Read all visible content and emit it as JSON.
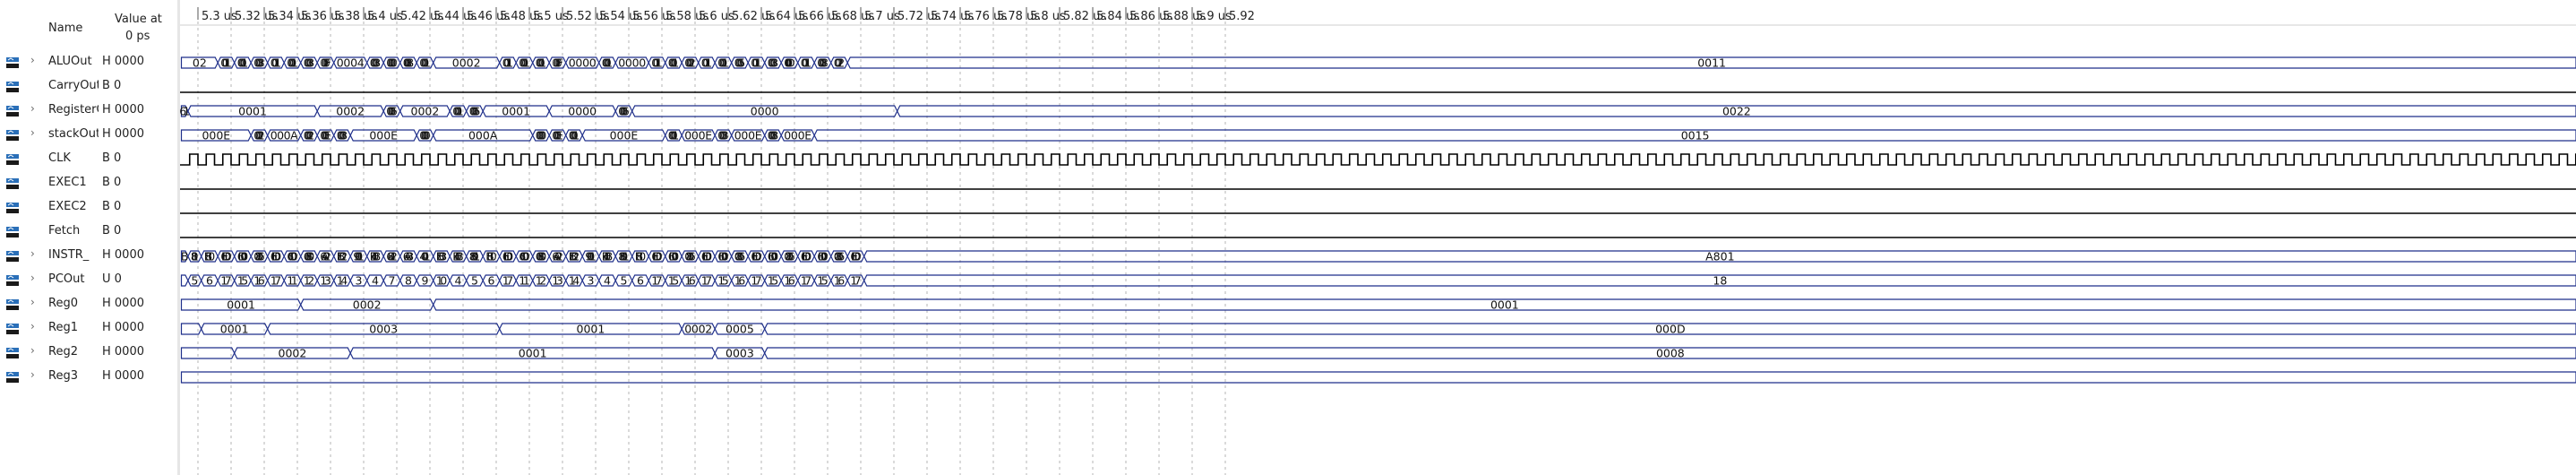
{
  "header": {
    "name_label": "Name",
    "value_label_line1": "Value at",
    "value_label_line2": "0 ps"
  },
  "colors": {
    "bus": "#1f2f8a",
    "clock": "#000000",
    "grid": "#b4b4b4",
    "icon_blue": "#2a6fb8",
    "icon_dark": "#1a1a1a"
  },
  "timeline": {
    "unit": "us",
    "ticks": [
      "5.3 us",
      "5.32 us",
      "5.34 us",
      "5.36 us",
      "5.38 us",
      "5.4 us",
      "5.42 us",
      "5.44 us",
      "5.46 us",
      "5.48 us",
      "5.5 us",
      "5.52 us",
      "5.54 us",
      "5.56 us",
      "5.58 us",
      "5.6 us",
      "5.62 us",
      "5.64 us",
      "5.66 us",
      "5.68 us",
      "5.7 us",
      "5.72 us",
      "5.74 us",
      "5.76 us",
      "5.78 us",
      "5.8 us",
      "5.82 us",
      "5.84 us",
      "5.86 us",
      "5.88 us",
      "5.9 us",
      "5.92"
    ],
    "start": 5.292,
    "end": 5.928,
    "data_end": 5.721
  },
  "signals": [
    {
      "name": "ALUOut",
      "value": "H 0000",
      "expandable": true,
      "kind": "bus",
      "segments": [
        [
          5.29,
          "02"
        ],
        [
          5.312,
          "0011"
        ],
        [
          5.322,
          "0001"
        ],
        [
          5.332,
          "0003"
        ],
        [
          5.342,
          "0011"
        ],
        [
          5.352,
          "0001"
        ],
        [
          5.362,
          "0003"
        ],
        [
          5.372,
          "000F"
        ],
        [
          5.382,
          "0004"
        ],
        [
          5.402,
          "0003"
        ],
        [
          5.412,
          "0000"
        ],
        [
          5.422,
          "000B"
        ],
        [
          5.432,
          "0001"
        ],
        [
          5.442,
          "0002"
        ],
        [
          5.482,
          "0011"
        ],
        [
          5.492,
          "0001"
        ],
        [
          5.502,
          "0001"
        ],
        [
          5.512,
          "000F"
        ],
        [
          5.522,
          "0000"
        ],
        [
          5.542,
          "0001"
        ],
        [
          5.552,
          "0000"
        ],
        [
          5.572,
          "0011"
        ],
        [
          5.582,
          "0001"
        ],
        [
          5.592,
          "0002"
        ],
        [
          5.602,
          "0011"
        ],
        [
          5.612,
          "0001"
        ],
        [
          5.622,
          "0005"
        ],
        [
          5.632,
          "0011"
        ],
        [
          5.642,
          "0003"
        ],
        [
          5.652,
          "000D"
        ],
        [
          5.662,
          "0011"
        ],
        [
          5.672,
          "0008"
        ],
        [
          5.682,
          "0022"
        ],
        [
          5.692,
          "0011"
        ]
      ]
    },
    {
      "name": "CarryOut",
      "value": "B 0",
      "expandable": false,
      "kind": "bit",
      "segments": [
        [
          5.29,
          0
        ]
      ]
    },
    {
      "name": "RegisterOut",
      "value": "H 0000",
      "expandable": true,
      "kind": "bus",
      "segments": [
        [
          5.29,
          "16"
        ],
        [
          5.294,
          "0001"
        ],
        [
          5.372,
          "0002"
        ],
        [
          5.412,
          "0006"
        ],
        [
          5.422,
          "0002"
        ],
        [
          5.452,
          "0001"
        ],
        [
          5.462,
          "0006"
        ],
        [
          5.472,
          "0001"
        ],
        [
          5.512,
          "0000"
        ],
        [
          5.552,
          "0006"
        ],
        [
          5.562,
          "0000"
        ],
        [
          5.722,
          "0022"
        ]
      ]
    },
    {
      "name": "stackOut",
      "value": "H 0000",
      "expandable": true,
      "kind": "bus",
      "segments": [
        [
          5.29,
          "000E"
        ],
        [
          5.332,
          "0002"
        ],
        [
          5.342,
          "000A"
        ],
        [
          5.362,
          "0002"
        ],
        [
          5.372,
          "000E"
        ],
        [
          5.382,
          "0003"
        ],
        [
          5.392,
          "000E"
        ],
        [
          5.432,
          "0000"
        ],
        [
          5.442,
          "000A"
        ],
        [
          5.502,
          "0000"
        ],
        [
          5.512,
          "000E"
        ],
        [
          5.522,
          "0001"
        ],
        [
          5.532,
          "000E"
        ],
        [
          5.582,
          "0001"
        ],
        [
          5.592,
          "000E"
        ],
        [
          5.612,
          "0003"
        ],
        [
          5.622,
          "000E"
        ],
        [
          5.642,
          "0008"
        ],
        [
          5.652,
          "000E"
        ],
        [
          5.672,
          "0015"
        ]
      ]
    },
    {
      "name": "CLK",
      "value": "B 0",
      "expandable": false,
      "kind": "clock",
      "period": 0.01
    },
    {
      "name": "EXEC1",
      "value": "B 0",
      "expandable": false,
      "kind": "bit",
      "segments": [
        [
          5.29,
          0
        ]
      ]
    },
    {
      "name": "EXEC2",
      "value": "B 0",
      "expandable": false,
      "kind": "bit",
      "segments": [
        [
          5.29,
          0
        ]
      ]
    },
    {
      "name": "Fetch",
      "value": "B 0",
      "expandable": false,
      "kind": "bit",
      "segments": [
        [
          5.29,
          0
        ]
      ]
    },
    {
      "name": "INSTR_",
      "value": "H 0000",
      "expandable": true,
      "kind": "bus",
      "segments": [
        [
          5.29,
          "B"
        ],
        [
          5.294,
          "8801"
        ],
        [
          5.302,
          "E810"
        ],
        [
          5.312,
          "6ED0"
        ],
        [
          5.322,
          "6D00"
        ],
        [
          5.332,
          "0806"
        ],
        [
          5.342,
          "6ED0"
        ],
        [
          5.352,
          "6C00"
        ],
        [
          5.362,
          "6880"
        ],
        [
          5.372,
          "6A02"
        ],
        [
          5.382,
          "E802"
        ],
        [
          5.392,
          "9001"
        ],
        [
          5.402,
          "E40B"
        ],
        [
          5.412,
          "6842"
        ],
        [
          5.422,
          "6A03"
        ],
        [
          5.432,
          "4001"
        ],
        [
          5.442,
          "E803"
        ],
        [
          5.452,
          "E40B"
        ],
        [
          5.462,
          "8801"
        ],
        [
          5.472,
          "E810"
        ],
        [
          5.482,
          "6ED0"
        ],
        [
          5.492,
          "6C00"
        ],
        [
          5.502,
          "6880"
        ],
        [
          5.512,
          "6A02"
        ],
        [
          5.522,
          "E802"
        ],
        [
          5.532,
          "9001"
        ],
        [
          5.542,
          "E40B"
        ],
        [
          5.552,
          "8801"
        ],
        [
          5.562,
          "E810"
        ],
        [
          5.572,
          "6ED0"
        ],
        [
          5.582,
          "6D00"
        ],
        [
          5.592,
          "0806"
        ],
        [
          5.602,
          "6ED0"
        ],
        [
          5.612,
          "6D00"
        ],
        [
          5.622,
          "0806"
        ],
        [
          5.632,
          "6ED0"
        ],
        [
          5.642,
          "6D00"
        ],
        [
          5.652,
          "0806"
        ],
        [
          5.662,
          "6ED0"
        ],
        [
          5.672,
          "6D00"
        ],
        [
          5.682,
          "0806"
        ],
        [
          5.692,
          "6ED0"
        ],
        [
          5.702,
          "A801"
        ]
      ]
    },
    {
      "name": "PCOut",
      "value": "U 0",
      "expandable": true,
      "kind": "bus",
      "segments": [
        [
          5.29,
          ""
        ],
        [
          5.294,
          "5"
        ],
        [
          5.302,
          "6"
        ],
        [
          5.312,
          "17"
        ],
        [
          5.322,
          "15"
        ],
        [
          5.332,
          "16"
        ],
        [
          5.342,
          "17"
        ],
        [
          5.352,
          "11"
        ],
        [
          5.362,
          "12"
        ],
        [
          5.372,
          "13"
        ],
        [
          5.382,
          "14"
        ],
        [
          5.392,
          "3"
        ],
        [
          5.402,
          "4"
        ],
        [
          5.412,
          "7"
        ],
        [
          5.422,
          "8"
        ],
        [
          5.432,
          "9"
        ],
        [
          5.442,
          "10"
        ],
        [
          5.452,
          "4"
        ],
        [
          5.462,
          "5"
        ],
        [
          5.472,
          "6"
        ],
        [
          5.482,
          "17"
        ],
        [
          5.492,
          "11"
        ],
        [
          5.502,
          "12"
        ],
        [
          5.512,
          "13"
        ],
        [
          5.522,
          "14"
        ],
        [
          5.532,
          "3"
        ],
        [
          5.542,
          "4"
        ],
        [
          5.552,
          "5"
        ],
        [
          5.562,
          "6"
        ],
        [
          5.572,
          "17"
        ],
        [
          5.582,
          "15"
        ],
        [
          5.592,
          "16"
        ],
        [
          5.602,
          "17"
        ],
        [
          5.612,
          "15"
        ],
        [
          5.622,
          "16"
        ],
        [
          5.632,
          "17"
        ],
        [
          5.642,
          "15"
        ],
        [
          5.652,
          "16"
        ],
        [
          5.662,
          "17"
        ],
        [
          5.672,
          "15"
        ],
        [
          5.682,
          "16"
        ],
        [
          5.692,
          "17"
        ],
        [
          5.702,
          "18"
        ]
      ]
    },
    {
      "name": "Reg0",
      "value": "H 0000",
      "expandable": true,
      "kind": "bus",
      "segments": [
        [
          5.29,
          "0001"
        ],
        [
          5.362,
          "0002"
        ],
        [
          5.442,
          "0001"
        ]
      ]
    },
    {
      "name": "Reg1",
      "value": "H 0000",
      "expandable": true,
      "kind": "bus",
      "segments": [
        [
          5.29,
          ""
        ],
        [
          5.302,
          "0001"
        ],
        [
          5.342,
          "0003"
        ],
        [
          5.482,
          "0001"
        ],
        [
          5.592,
          "0002"
        ],
        [
          5.612,
          "0005"
        ],
        [
          5.642,
          "000D"
        ]
      ]
    },
    {
      "name": "Reg2",
      "value": "H 0000",
      "expandable": true,
      "kind": "bus",
      "segments": [
        [
          5.29,
          ""
        ],
        [
          5.322,
          "0002"
        ],
        [
          5.392,
          "0001"
        ],
        [
          5.612,
          "0003"
        ],
        [
          5.642,
          "0008"
        ]
      ]
    },
    {
      "name": "Reg3",
      "value": "H 0000",
      "expandable": true,
      "kind": "bus",
      "segments": [
        [
          5.29,
          ""
        ]
      ]
    }
  ]
}
